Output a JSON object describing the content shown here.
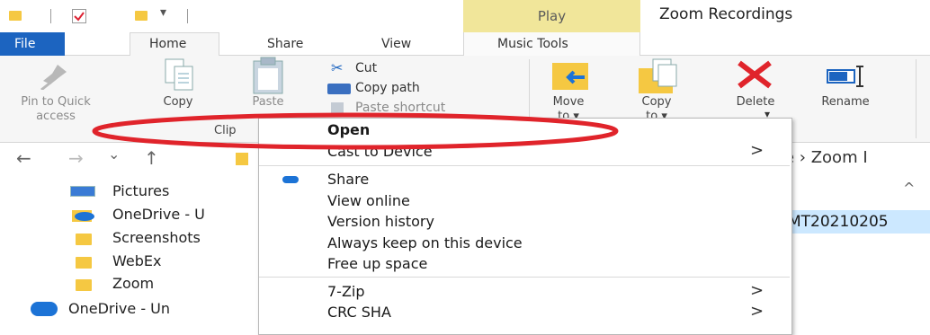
{
  "window": {
    "title": "Zoom Recordings",
    "contextual_tab": "Play"
  },
  "tabs": {
    "file": "File",
    "home": "Home",
    "share": "Share",
    "view": "View",
    "music_tools": "Music Tools"
  },
  "ribbon": {
    "pin_line1": "Pin to Quick",
    "pin_line2": "access",
    "copy": "Copy",
    "paste": "Paste",
    "cut": "Cut",
    "copy_path": "Copy path",
    "paste_shortcut": "Paste shortcut",
    "move_to": "Move",
    "move_to_line2": "to ▾",
    "copy_to": "Copy",
    "copy_to_line2": "to ▾",
    "delete": "Delete",
    "rename": "Rename",
    "clipboard_group": "Clip"
  },
  "nav": {
    "back": "←",
    "forward": "→",
    "recent": "⌄",
    "up": "↑",
    "address_tail": "e  ›  Zoom I"
  },
  "sidebar": {
    "items": [
      {
        "label": "Pictures"
      },
      {
        "label": "OneDrive - U"
      },
      {
        "label": "Screenshots"
      },
      {
        "label": "WebEx"
      },
      {
        "label": "Zoom"
      },
      {
        "label": "OneDrive - Un"
      }
    ]
  },
  "files": {
    "selected_name": "MT20210205",
    "sort_caret": "^"
  },
  "context_menu": {
    "open": "Open",
    "cast": "Cast to Device",
    "share": "Share",
    "view_online": "View online",
    "version_history": "Version history",
    "keep": "Always keep on this device",
    "free_up": "Free up space",
    "zip": "7-Zip",
    "crc": "CRC SHA",
    "arrow": ">"
  },
  "colors": {
    "accent": "#1c64c0",
    "play_band": "#f1e69a",
    "annotation": "#e0242b",
    "selection": "#cce8ff"
  }
}
